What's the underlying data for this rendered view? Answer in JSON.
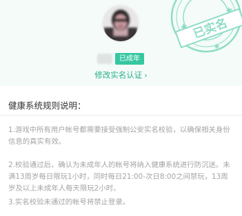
{
  "header": {
    "badge_label": "已成年",
    "modify_link_label": "修改实名认证",
    "modify_link_chevron": "›",
    "stamp_text": "已实名"
  },
  "rules": {
    "title": "健康系统规则说明：",
    "items": [
      "1.游戏中所有用户帐号都需要接受强制公安实名校验，以确保相关身份信息的真实有效。",
      "2.校验通过后，确认为未成年人的帐号将纳入健康系统进行防沉迷。未满13周岁每日限玩1小时，同时每日21:00-次日8:00之间禁玩，13周岁及以上未成年人每天限玩2小时。",
      "3.实名校验未通过的帐号将禁止登录。"
    ]
  },
  "colors": {
    "accent": "#35c7a0",
    "link": "#27ae8b",
    "header_bg": "#f4fbf8",
    "stamp": "#8fdcc6"
  },
  "icons": [
    "avatar",
    "chevron-right-icon",
    "stamp-icon"
  ]
}
